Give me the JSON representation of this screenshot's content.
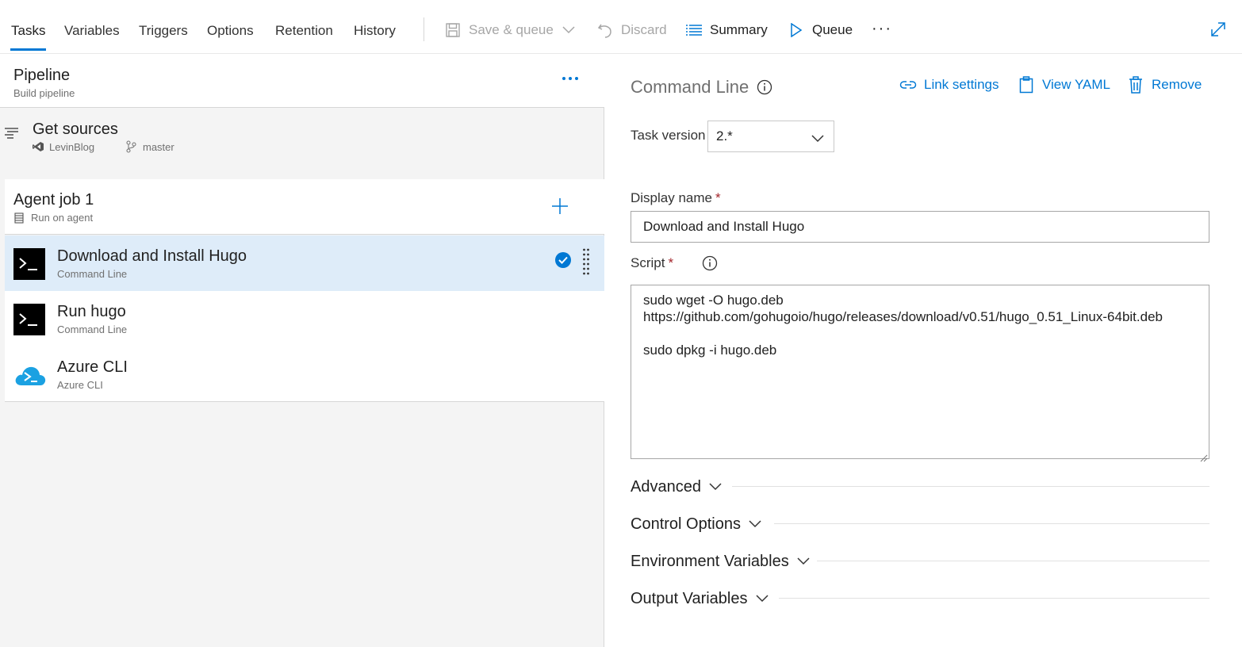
{
  "tabs": [
    {
      "label": "Tasks"
    },
    {
      "label": "Variables"
    },
    {
      "label": "Triggers"
    },
    {
      "label": "Options"
    },
    {
      "label": "Retention"
    },
    {
      "label": "History"
    }
  ],
  "toolbar": {
    "save_queue_label": "Save & queue",
    "discard_label": "Discard",
    "summary_label": "Summary",
    "queue_label": "Queue",
    "more_label": "···"
  },
  "pipeline": {
    "title": "Pipeline",
    "subtitle": "Build pipeline"
  },
  "sources": {
    "title": "Get sources",
    "repo": "LevinBlog",
    "branch": "master"
  },
  "agent_job": {
    "title": "Agent job 1",
    "subtitle": "Run on agent"
  },
  "tasks": [
    {
      "name": "Download and Install Hugo",
      "type": "Command Line",
      "icon": "terminal-icon",
      "selected": true
    },
    {
      "name": "Run hugo",
      "type": "Command Line",
      "icon": "terminal-icon",
      "selected": false
    },
    {
      "name": "Azure CLI",
      "type": "Azure CLI",
      "icon": "azure-cloud-icon",
      "selected": false
    }
  ],
  "detail": {
    "title": "Command Line",
    "links": {
      "link_settings": "Link settings",
      "view_yaml": "View YAML",
      "remove": "Remove"
    },
    "task_version": {
      "label": "Task version",
      "value": "2.*"
    },
    "display_name": {
      "label": "Display name",
      "required": "*",
      "value": "Download and Install Hugo"
    },
    "script": {
      "label": "Script",
      "required": "*",
      "lines": [
        "sudo wget -O hugo.deb",
        "https://github.com/gohugoio/hugo/releases/download/v0.51/hugo_0.51_Linux-64bit.deb",
        "",
        "sudo dpkg -i hugo.deb"
      ]
    },
    "sections": [
      {
        "label": "Advanced"
      },
      {
        "label": "Control Options"
      },
      {
        "label": "Environment Variables"
      },
      {
        "label": "Output Variables"
      }
    ]
  },
  "colors": {
    "accent": "#0078d4",
    "selected_row": "#deecf9",
    "panel_bg": "#f4f4f4",
    "required": "#a4262c",
    "azure": "#1ba1e2"
  }
}
